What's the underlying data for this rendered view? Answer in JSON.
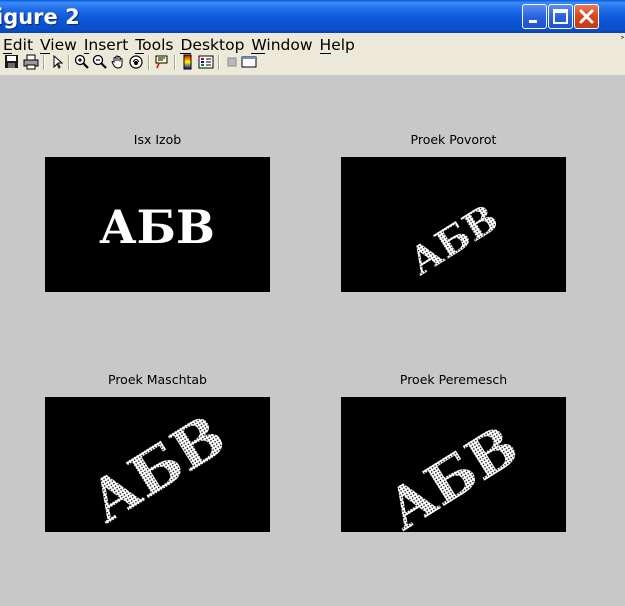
{
  "window": {
    "title": "igure 2",
    "accent": "#0a4fc9"
  },
  "menu": {
    "items": [
      {
        "label": "Edit",
        "underline": "E"
      },
      {
        "label": "View",
        "underline": "V"
      },
      {
        "label": "Insert",
        "underline": "I"
      },
      {
        "label": "Tools",
        "underline": "T"
      },
      {
        "label": "Desktop",
        "underline": "D"
      },
      {
        "label": "Window",
        "underline": "W"
      },
      {
        "label": "Help",
        "underline": "H"
      }
    ],
    "overflow_icon": "chevron-icon"
  },
  "toolbar": {
    "buttons": [
      "save-icon",
      "print-icon",
      "pointer-icon",
      "zoom-in-icon",
      "zoom-out-icon",
      "pan-icon",
      "rotate-3d-icon",
      "data-cursor-icon",
      "colorbar-icon",
      "legend-icon",
      "plot-tools-hide-icon",
      "plot-tools-show-icon"
    ]
  },
  "axes": [
    {
      "title": "Isx Izob",
      "image_text": "АБВ",
      "style": "solid"
    },
    {
      "title": "Proek Povorot",
      "image_text": "АБВ",
      "style": "rotated-dotted"
    },
    {
      "title": "Proek Maschtab",
      "image_text": "АБВ",
      "style": "scaled-dotted"
    },
    {
      "title": "Proek Peremesch",
      "image_text": "АБВ",
      "style": "shifted-dotted"
    }
  ]
}
